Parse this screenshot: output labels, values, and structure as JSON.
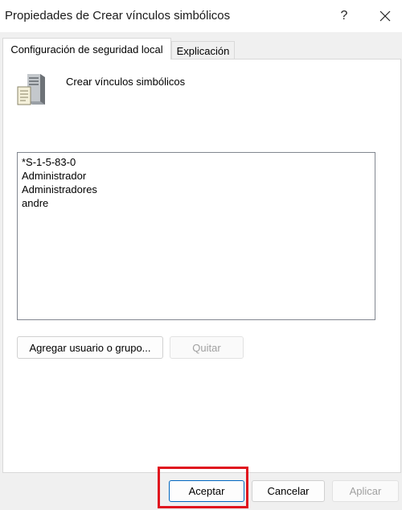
{
  "window": {
    "title": "Propiedades de Crear vínculos simbólicos",
    "help_label": "?",
    "close_label": "close"
  },
  "tabs": [
    {
      "label": "Configuración de seguridad local",
      "active": true
    },
    {
      "label": "Explicación",
      "active": false
    }
  ],
  "policy": {
    "icon": "server-icon",
    "name": "Crear vínculos simbólicos"
  },
  "members": [
    "*S-1-5-83-0",
    "Administrador",
    "Administradores",
    "andre"
  ],
  "actions": {
    "add_label": "Agregar usuario o grupo...",
    "remove_label": "Quitar"
  },
  "footer": {
    "ok_label": "Aceptar",
    "cancel_label": "Cancelar",
    "apply_label": "Aplicar"
  },
  "colors": {
    "highlight": "#e0141e",
    "default_button_border": "#0067c0"
  }
}
